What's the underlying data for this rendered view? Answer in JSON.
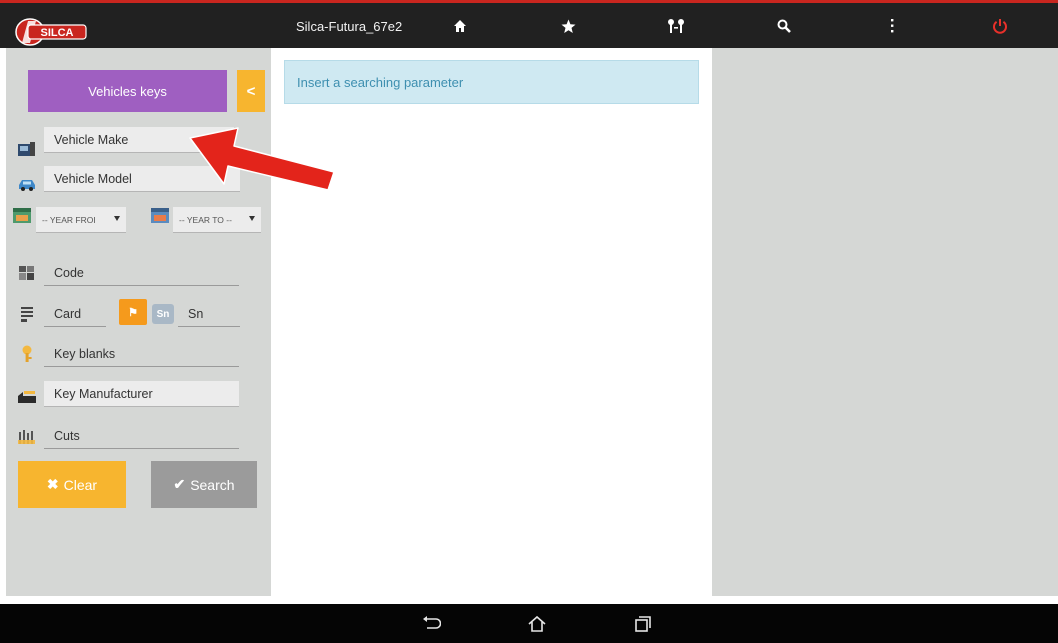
{
  "header": {
    "logo_text": "SILCA",
    "title": "Silca-Futura_67e2",
    "icons": [
      "home-icon",
      "star-icon",
      "keys-compare-icon",
      "search-icon",
      "more-vert-icon",
      "power-icon"
    ],
    "power_color": "#e8302a"
  },
  "sidebar": {
    "category_button": "Vehicles keys",
    "collapse_label": "<",
    "fields": {
      "vehicle_make": "Vehicle Make",
      "vehicle_model": "Vehicle Model",
      "year_from": "-- YEAR FROI",
      "year_to": "-- YEAR TO --",
      "code": "Code",
      "card": "Card",
      "sn_badge": "Sn",
      "sn": "Sn",
      "key_blanks": "Key blanks",
      "key_manufacturer": "Key Manufacturer",
      "cuts": "Cuts"
    },
    "clear_button": "Clear",
    "search_button": "Search"
  },
  "main": {
    "message": "Insert a searching parameter"
  },
  "colors": {
    "accent_purple": "#9f5fc1",
    "accent_orange": "#f7b52f",
    "panel_gray": "#d5d7d5",
    "info_blue": "#cfe9f2",
    "annotation_red": "#e3241b"
  },
  "navbar": {
    "icons": [
      "back-icon",
      "home-outline-icon",
      "recent-apps-icon"
    ]
  }
}
